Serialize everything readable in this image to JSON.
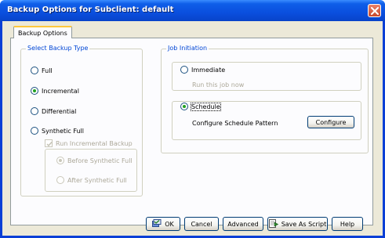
{
  "window": {
    "title": "Backup Options for Subclient: default"
  },
  "tabs": [
    {
      "label": "Backup Options",
      "active": true
    }
  ],
  "backup_type": {
    "legend": "Select Backup Type",
    "options": [
      {
        "label": "Full",
        "selected": false
      },
      {
        "label": "Incremental",
        "selected": true
      },
      {
        "label": "Differential",
        "selected": false
      },
      {
        "label": "Synthetic Full",
        "selected": false
      }
    ],
    "run_incremental": {
      "label": "Run Incremental Backup",
      "checked": true,
      "enabled": false
    },
    "sub_options": [
      {
        "label": "Before Synthetic Full",
        "selected": true,
        "enabled": false
      },
      {
        "label": "After Synthetic Full",
        "selected": false,
        "enabled": false
      }
    ]
  },
  "job_initiation": {
    "legend": "Job Initiation",
    "immediate": {
      "label": "Immediate",
      "selected": false,
      "description": "Run this job now"
    },
    "schedule": {
      "label": "Schedule",
      "selected": true,
      "description": "Configure Schedule Pattern",
      "button": "Configure"
    }
  },
  "footer": {
    "ok": "OK",
    "cancel": "Cancel",
    "advanced": "Advanced",
    "save_as_script": "Save As Script",
    "help": "Help"
  },
  "colors": {
    "titlebar": "#0a4fde",
    "legend_text": "#0046d5",
    "client_bg": "#ece9d8",
    "panel_bg": "#fcfcfe"
  }
}
